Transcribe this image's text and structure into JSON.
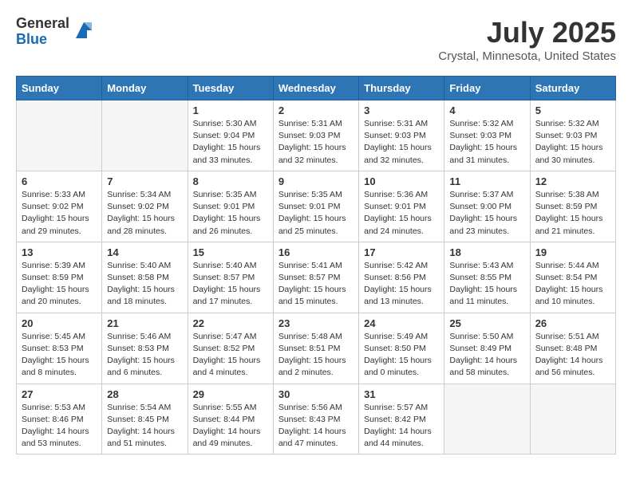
{
  "header": {
    "logo_general": "General",
    "logo_blue": "Blue",
    "month_title": "July 2025",
    "location": "Crystal, Minnesota, United States"
  },
  "days_of_week": [
    "Sunday",
    "Monday",
    "Tuesday",
    "Wednesday",
    "Thursday",
    "Friday",
    "Saturday"
  ],
  "weeks": [
    [
      {
        "day": "",
        "empty": true
      },
      {
        "day": "",
        "empty": true
      },
      {
        "day": "1",
        "sunrise": "Sunrise: 5:30 AM",
        "sunset": "Sunset: 9:04 PM",
        "daylight": "Daylight: 15 hours and 33 minutes."
      },
      {
        "day": "2",
        "sunrise": "Sunrise: 5:31 AM",
        "sunset": "Sunset: 9:03 PM",
        "daylight": "Daylight: 15 hours and 32 minutes."
      },
      {
        "day": "3",
        "sunrise": "Sunrise: 5:31 AM",
        "sunset": "Sunset: 9:03 PM",
        "daylight": "Daylight: 15 hours and 32 minutes."
      },
      {
        "day": "4",
        "sunrise": "Sunrise: 5:32 AM",
        "sunset": "Sunset: 9:03 PM",
        "daylight": "Daylight: 15 hours and 31 minutes."
      },
      {
        "day": "5",
        "sunrise": "Sunrise: 5:32 AM",
        "sunset": "Sunset: 9:03 PM",
        "daylight": "Daylight: 15 hours and 30 minutes."
      }
    ],
    [
      {
        "day": "6",
        "sunrise": "Sunrise: 5:33 AM",
        "sunset": "Sunset: 9:02 PM",
        "daylight": "Daylight: 15 hours and 29 minutes."
      },
      {
        "day": "7",
        "sunrise": "Sunrise: 5:34 AM",
        "sunset": "Sunset: 9:02 PM",
        "daylight": "Daylight: 15 hours and 28 minutes."
      },
      {
        "day": "8",
        "sunrise": "Sunrise: 5:35 AM",
        "sunset": "Sunset: 9:01 PM",
        "daylight": "Daylight: 15 hours and 26 minutes."
      },
      {
        "day": "9",
        "sunrise": "Sunrise: 5:35 AM",
        "sunset": "Sunset: 9:01 PM",
        "daylight": "Daylight: 15 hours and 25 minutes."
      },
      {
        "day": "10",
        "sunrise": "Sunrise: 5:36 AM",
        "sunset": "Sunset: 9:01 PM",
        "daylight": "Daylight: 15 hours and 24 minutes."
      },
      {
        "day": "11",
        "sunrise": "Sunrise: 5:37 AM",
        "sunset": "Sunset: 9:00 PM",
        "daylight": "Daylight: 15 hours and 23 minutes."
      },
      {
        "day": "12",
        "sunrise": "Sunrise: 5:38 AM",
        "sunset": "Sunset: 8:59 PM",
        "daylight": "Daylight: 15 hours and 21 minutes."
      }
    ],
    [
      {
        "day": "13",
        "sunrise": "Sunrise: 5:39 AM",
        "sunset": "Sunset: 8:59 PM",
        "daylight": "Daylight: 15 hours and 20 minutes."
      },
      {
        "day": "14",
        "sunrise": "Sunrise: 5:40 AM",
        "sunset": "Sunset: 8:58 PM",
        "daylight": "Daylight: 15 hours and 18 minutes."
      },
      {
        "day": "15",
        "sunrise": "Sunrise: 5:40 AM",
        "sunset": "Sunset: 8:57 PM",
        "daylight": "Daylight: 15 hours and 17 minutes."
      },
      {
        "day": "16",
        "sunrise": "Sunrise: 5:41 AM",
        "sunset": "Sunset: 8:57 PM",
        "daylight": "Daylight: 15 hours and 15 minutes."
      },
      {
        "day": "17",
        "sunrise": "Sunrise: 5:42 AM",
        "sunset": "Sunset: 8:56 PM",
        "daylight": "Daylight: 15 hours and 13 minutes."
      },
      {
        "day": "18",
        "sunrise": "Sunrise: 5:43 AM",
        "sunset": "Sunset: 8:55 PM",
        "daylight": "Daylight: 15 hours and 11 minutes."
      },
      {
        "day": "19",
        "sunrise": "Sunrise: 5:44 AM",
        "sunset": "Sunset: 8:54 PM",
        "daylight": "Daylight: 15 hours and 10 minutes."
      }
    ],
    [
      {
        "day": "20",
        "sunrise": "Sunrise: 5:45 AM",
        "sunset": "Sunset: 8:53 PM",
        "daylight": "Daylight: 15 hours and 8 minutes."
      },
      {
        "day": "21",
        "sunrise": "Sunrise: 5:46 AM",
        "sunset": "Sunset: 8:53 PM",
        "daylight": "Daylight: 15 hours and 6 minutes."
      },
      {
        "day": "22",
        "sunrise": "Sunrise: 5:47 AM",
        "sunset": "Sunset: 8:52 PM",
        "daylight": "Daylight: 15 hours and 4 minutes."
      },
      {
        "day": "23",
        "sunrise": "Sunrise: 5:48 AM",
        "sunset": "Sunset: 8:51 PM",
        "daylight": "Daylight: 15 hours and 2 minutes."
      },
      {
        "day": "24",
        "sunrise": "Sunrise: 5:49 AM",
        "sunset": "Sunset: 8:50 PM",
        "daylight": "Daylight: 15 hours and 0 minutes."
      },
      {
        "day": "25",
        "sunrise": "Sunrise: 5:50 AM",
        "sunset": "Sunset: 8:49 PM",
        "daylight": "Daylight: 14 hours and 58 minutes."
      },
      {
        "day": "26",
        "sunrise": "Sunrise: 5:51 AM",
        "sunset": "Sunset: 8:48 PM",
        "daylight": "Daylight: 14 hours and 56 minutes."
      }
    ],
    [
      {
        "day": "27",
        "sunrise": "Sunrise: 5:53 AM",
        "sunset": "Sunset: 8:46 PM",
        "daylight": "Daylight: 14 hours and 53 minutes."
      },
      {
        "day": "28",
        "sunrise": "Sunrise: 5:54 AM",
        "sunset": "Sunset: 8:45 PM",
        "daylight": "Daylight: 14 hours and 51 minutes."
      },
      {
        "day": "29",
        "sunrise": "Sunrise: 5:55 AM",
        "sunset": "Sunset: 8:44 PM",
        "daylight": "Daylight: 14 hours and 49 minutes."
      },
      {
        "day": "30",
        "sunrise": "Sunrise: 5:56 AM",
        "sunset": "Sunset: 8:43 PM",
        "daylight": "Daylight: 14 hours and 47 minutes."
      },
      {
        "day": "31",
        "sunrise": "Sunrise: 5:57 AM",
        "sunset": "Sunset: 8:42 PM",
        "daylight": "Daylight: 14 hours and 44 minutes."
      },
      {
        "day": "",
        "empty": true
      },
      {
        "day": "",
        "empty": true
      }
    ]
  ]
}
